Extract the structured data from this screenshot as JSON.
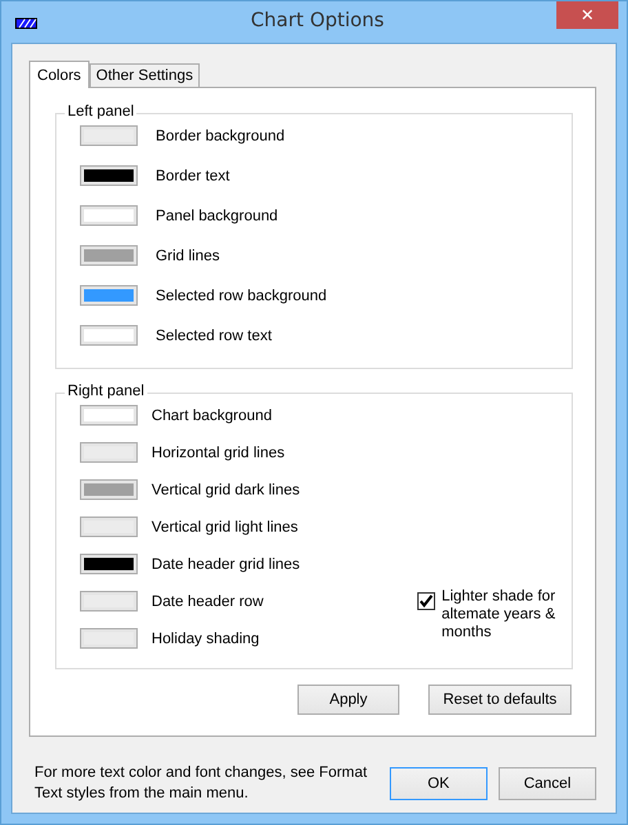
{
  "window": {
    "title": "Chart Options",
    "close": "✕"
  },
  "tabs": [
    {
      "label": "Colors",
      "selected": true
    },
    {
      "label": "Other Settings",
      "selected": false
    }
  ],
  "groups": [
    {
      "title": "Left panel",
      "items": [
        {
          "label": "Border background",
          "color": "#ececec"
        },
        {
          "label": "Border text",
          "color": "#000000"
        },
        {
          "label": "Panel background",
          "color": "#ffffff"
        },
        {
          "label": "Grid lines",
          "color": "#a0a0a0"
        },
        {
          "label": "Selected row background",
          "color": "#3399ff"
        },
        {
          "label": "Selected row text",
          "color": "#ffffff"
        }
      ]
    },
    {
      "title": "Right panel",
      "items": [
        {
          "label": "Chart background",
          "color": "#ffffff"
        },
        {
          "label": "Horizontal grid lines",
          "color": "#ececec"
        },
        {
          "label": "Vertical grid dark lines",
          "color": "#a0a0a0"
        },
        {
          "label": "Vertical grid light lines",
          "color": "#ececec"
        },
        {
          "label": "Date header grid lines",
          "color": "#000000"
        },
        {
          "label": "Date header row",
          "color": "#ececec"
        },
        {
          "label": "Holiday shading",
          "color": "#ececec"
        }
      ],
      "checkbox": {
        "label": "Lighter shade for altemate years & months",
        "checked": true
      }
    }
  ],
  "panel_buttons": [
    "Apply",
    "Reset to defaults"
  ],
  "footer_note": "For more text color and font changes, see Format Text styles from the main menu.",
  "dialog_buttons": [
    {
      "label": "OK",
      "default": true
    },
    {
      "label": "Cancel",
      "default": false
    }
  ]
}
